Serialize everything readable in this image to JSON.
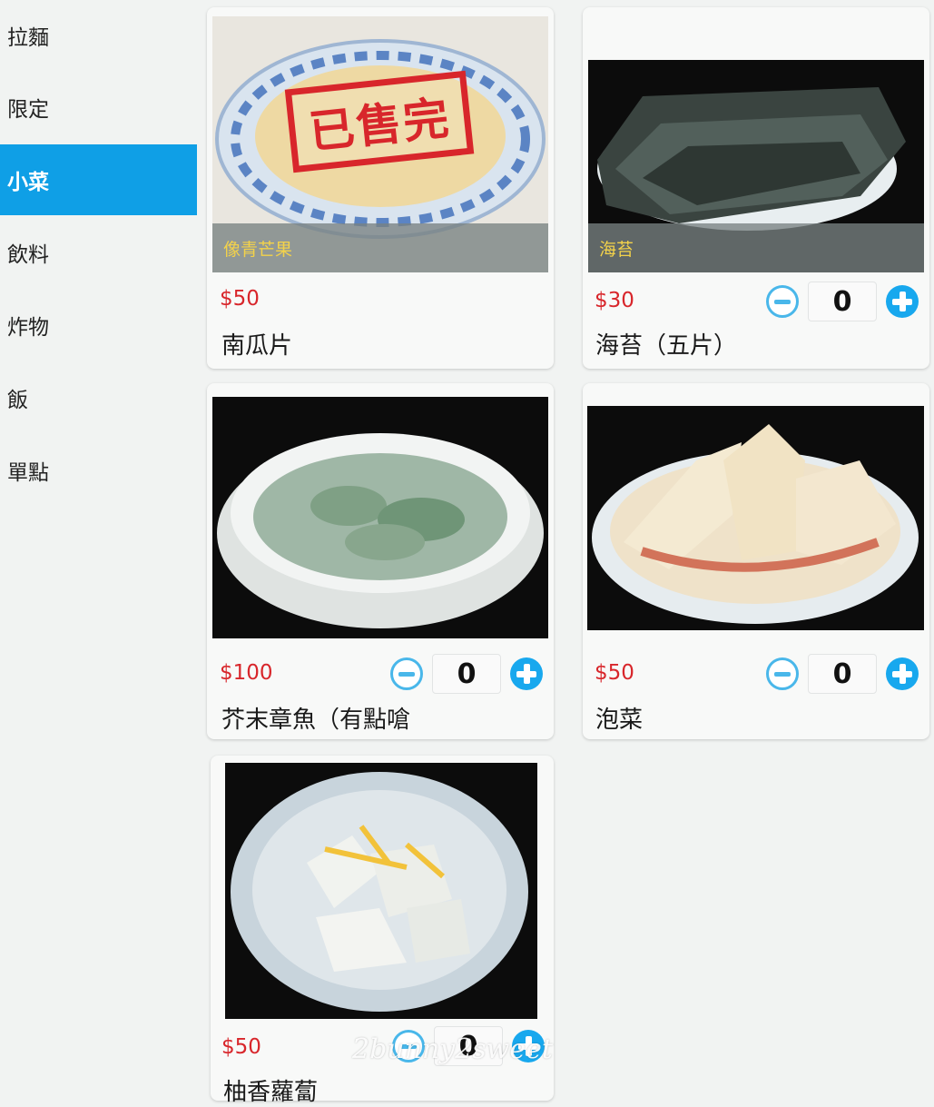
{
  "sidebar": {
    "categories": [
      "拉麵",
      "限定",
      "小菜",
      "飲料",
      "炸物",
      "飯",
      "單點"
    ],
    "active_index": 2
  },
  "items": [
    {
      "overlay_label": "像青芒果",
      "sold_out_stamp": "已售完",
      "price": "$50",
      "name": "南瓜片"
    },
    {
      "overlay_label": "海苔",
      "price": "$30",
      "quantity": "0",
      "name": "海苔（五片）"
    },
    {
      "price": "$100",
      "quantity": "0",
      "name": "芥末章魚（有點嗆"
    },
    {
      "price": "$50",
      "quantity": "0",
      "name": "泡菜"
    },
    {
      "price": "$50",
      "quantity": "0",
      "name": "柚香蘿蔔"
    }
  ],
  "watermark": "2bunny2sweet",
  "colors": {
    "accent": "#0f9fe6",
    "price": "#d8262b",
    "overlay_text": "#f3d24a"
  }
}
